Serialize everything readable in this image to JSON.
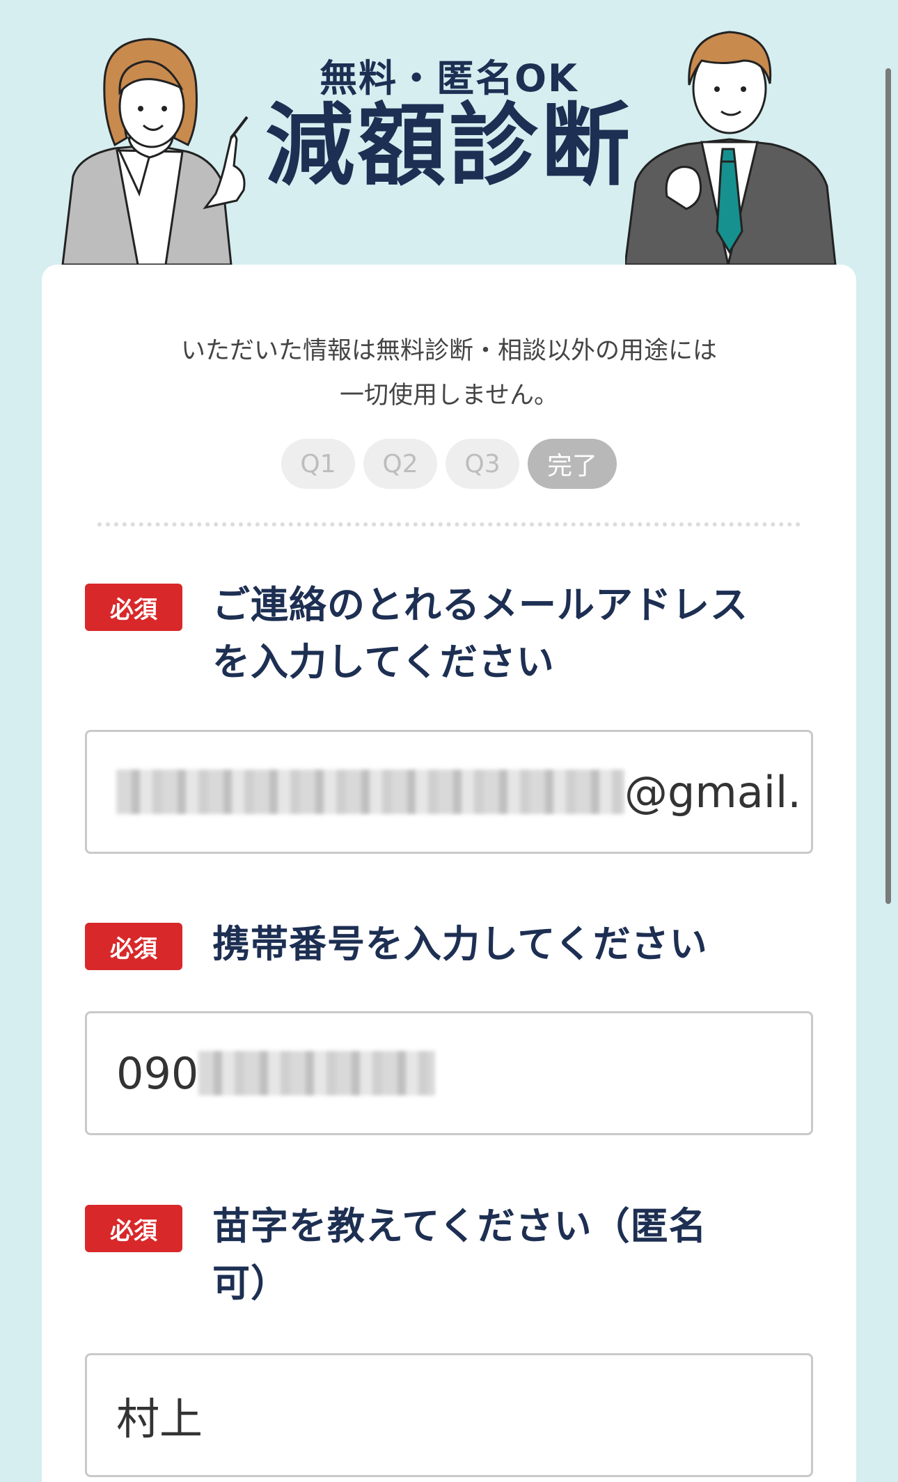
{
  "header": {
    "subtitle": "無料・匿名OK",
    "title": "減額診断"
  },
  "form": {
    "notice_line1": "いただいた情報は無料診断・相談以外の用途には",
    "notice_line2": "一切使用しません。",
    "steps": [
      {
        "label": "Q1",
        "active": false
      },
      {
        "label": "Q2",
        "active": false
      },
      {
        "label": "Q3",
        "active": false
      },
      {
        "label": "完了",
        "active": true
      }
    ],
    "questions": [
      {
        "badge": "必須",
        "label_line1": "ご連絡のとれるメールアドレス",
        "label_line2": "を入力してください",
        "value_visible": "@gmail."
      },
      {
        "badge": "必須",
        "label_line1": "携帯番号を入力してください",
        "value_visible": "090"
      },
      {
        "badge": "必須",
        "label_line1": "苗字を教えてください（匿名",
        "label_line2": "可）",
        "value": "村上"
      }
    ]
  },
  "colors": {
    "background": "#d6eef0",
    "navy": "#1d2f52",
    "required_badge": "#d8282a",
    "tie": "#16918f"
  }
}
